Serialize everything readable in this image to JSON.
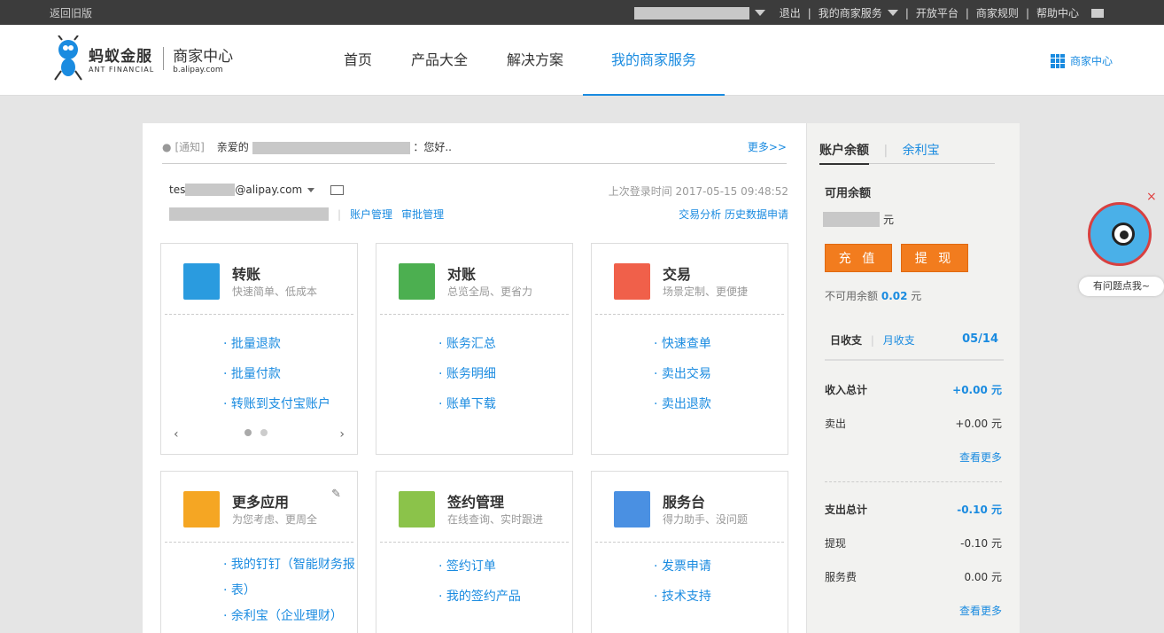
{
  "topbar": {
    "back": "返回旧版",
    "logout": "退出",
    "my_service": "我的商家服务",
    "open_platform": "开放平台",
    "rules": "商家规则",
    "help": "帮助中心",
    "mail_icon": "mail-icon"
  },
  "header": {
    "logo_cn": "蚂蚁金服",
    "logo_en": "ANT FINANCIAL",
    "logo_sub_cn": "商家中心",
    "logo_sub_en": "b.alipay.com",
    "nav": [
      "首页",
      "产品大全",
      "解决方案",
      "我的商家服务"
    ],
    "right_link": "商家中心"
  },
  "notice": {
    "tag": "[通知]",
    "greet": "亲爱的",
    "tail": "：您好..",
    "more": "更多>>"
  },
  "account": {
    "email_prefix": "tes",
    "email_suffix": "@alipay.com",
    "last_login": "上次登录时间 2017-05-15 09:48:52",
    "manage": "账户管理",
    "approve": "审批管理",
    "trade_analysis": "交易分析",
    "history": "历史数据申请",
    "sep": "|"
  },
  "cards": [
    {
      "title": "转账",
      "desc": "快速简单、低成本",
      "color": "#2a9bdf",
      "items": [
        "批量退款",
        "批量付款",
        "转账到支付宝账户"
      ]
    },
    {
      "title": "对账",
      "desc": "总览全局、更省力",
      "color": "#4caf50",
      "items": [
        "账务汇总",
        "账务明细",
        "账单下载"
      ]
    },
    {
      "title": "交易",
      "desc": "场景定制、更便捷",
      "color": "#f0604a",
      "items": [
        "快速查单",
        "卖出交易",
        "卖出退款"
      ]
    },
    {
      "title": "更多应用",
      "desc": "为您考虑、更周全",
      "color": "#f5a623",
      "items": [
        "我的钉钉（智能财务报",
        "表）",
        "余利宝（企业理财）"
      ]
    },
    {
      "title": "签约管理",
      "desc": "在线查询、实时跟进",
      "color": "#8bc34a",
      "items": [
        "签约订单",
        "我的签约产品"
      ]
    },
    {
      "title": "服务台",
      "desc": "得力助手、没问题",
      "color": "#4a90e2",
      "items": [
        "发票申请",
        "技术支持"
      ]
    }
  ],
  "side": {
    "tab1": "账户余额",
    "tab2": "余利宝",
    "tab_sep": "|",
    "avail_label": "可用余额",
    "yuan": "元",
    "recharge": "充 值",
    "withdraw": "提 现",
    "unavail_label": "不可用余额",
    "unavail_value": "0.02",
    "daily": "日收支",
    "monthly": "月收支",
    "date": "05/14",
    "income_total_label": "收入总计",
    "income_total": "+0.00 元",
    "sell_label": "卖出",
    "sell": "+0.00 元",
    "more1": "查看更多",
    "expense_total_label": "支出总计",
    "expense_total": "-0.10 元",
    "withdraw_label": "提现",
    "withdraw_v": "-0.10 元",
    "fee_label": "服务费",
    "fee": "0.00 元",
    "more2": "查看更多"
  },
  "bot": {
    "close": "×",
    "text": "有问题点我~"
  }
}
